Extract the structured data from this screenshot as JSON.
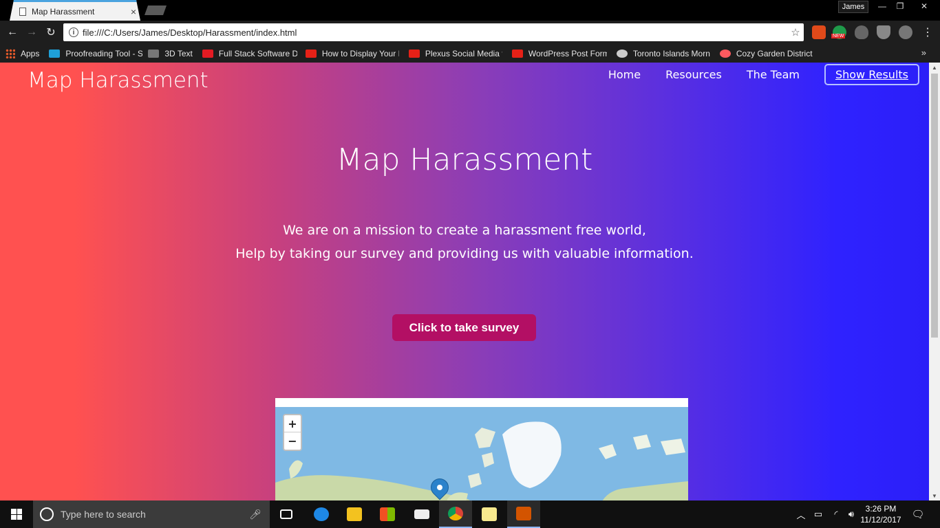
{
  "browser": {
    "tab_title": "Map Harassment",
    "tab_close": "×",
    "profile_name": "James",
    "window_controls": [
      "—",
      "❐",
      "✕"
    ],
    "url": "file:///C:/Users/James/Desktop/Harassment/index.html",
    "nav": {
      "back": "←",
      "forward": "→",
      "reload": "↻",
      "star": "☆",
      "info": "i"
    },
    "extension_badge": "NEW",
    "bookmarks": [
      {
        "label": "Apps",
        "icon": "apps-grid-icon",
        "color": "#e0582a"
      },
      {
        "label": "Proofreading Tool - S",
        "icon": "proofreading-icon",
        "color": "#1fa0d8"
      },
      {
        "label": "3D Text",
        "icon": "3d-text-icon",
        "color": "#777777"
      },
      {
        "label": "Full Stack Software De",
        "icon": "fullstack-icon",
        "color": "#e31b23"
      },
      {
        "label": "How to Display Your I",
        "icon": "youtube-icon",
        "color": "#e62117"
      },
      {
        "label": "Plexus Social Media t",
        "icon": "youtube-icon",
        "color": "#e62117"
      },
      {
        "label": "WordPress Post Form",
        "icon": "youtube-icon",
        "color": "#e62117"
      },
      {
        "label": "Toronto Islands Morn",
        "icon": "tripadvisor-icon",
        "color": "#cccccc"
      },
      {
        "label": "Cozy Garden District",
        "icon": "airbnb-icon",
        "color": "#ff5a5f"
      }
    ],
    "bookmarks_more": "»"
  },
  "site": {
    "brand": "Map Harassment",
    "nav": [
      "Home",
      "Resources",
      "The Team"
    ],
    "results_button": "Show Results",
    "hero_title": "Map Harassment",
    "hero_line1": "We are on a mission to create a harassment free world,",
    "hero_line2": "Help by taking our survey and providing us with valuable information.",
    "survey_button": "Click to take survey",
    "map": {
      "zoom_in": "+",
      "zoom_out": "−",
      "marker_count": 1
    },
    "colors": {
      "gradient_left": "#ff5150",
      "gradient_right": "#2b1ff8",
      "button": "#b30f64"
    }
  },
  "taskbar": {
    "search_placeholder": "Type here to search",
    "time": "3:26 PM",
    "date": "11/12/2017",
    "apps": [
      "task-view-icon",
      "edge-icon",
      "file-explorer-icon",
      "store-icon",
      "mail-icon",
      "chrome-icon",
      "sticky-notes-icon",
      "visual-studio-icon"
    ]
  }
}
